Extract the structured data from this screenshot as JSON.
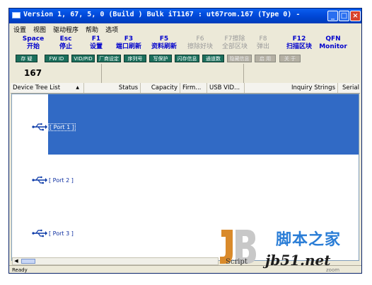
{
  "window": {
    "title": "Version 1, 67, 5, 0 (Build )  Bulk iT1167 : ut67rom.167  (Type 0)  -"
  },
  "menu": [
    "设置",
    "视图",
    "驱动程序",
    "帮助",
    "选项"
  ],
  "function_keys": [
    {
      "key": "Space",
      "label": "开始",
      "enabled": true
    },
    {
      "key": "Esc",
      "label": "停止",
      "enabled": true
    },
    {
      "key": "F1",
      "label": "设置",
      "enabled": true
    },
    {
      "key": "F3",
      "label": "端口刷新",
      "enabled": true
    },
    {
      "key": "F5",
      "label": "资料刷新",
      "enabled": true
    },
    {
      "key": "F6",
      "label": "擦除好块",
      "enabled": false
    },
    {
      "key": "F7擦除",
      "label": "全部区块",
      "enabled": false
    },
    {
      "key": "F8",
      "label": "弹出",
      "enabled": false
    },
    {
      "key": "F12",
      "label": "扫描区块",
      "enabled": true
    },
    {
      "key": "QFN",
      "label": "Monitor",
      "enabled": true
    }
  ],
  "tag_buttons": [
    {
      "label": "存 疑",
      "enabled": true
    },
    {
      "label": "FW ID",
      "enabled": true
    },
    {
      "label": "VID/PID",
      "enabled": true
    },
    {
      "label": "厂商设定",
      "enabled": true
    },
    {
      "label": "序列号",
      "enabled": true
    },
    {
      "label": "写保护",
      "enabled": true
    },
    {
      "label": "闪存信息",
      "enabled": true
    },
    {
      "label": "通道数",
      "enabled": true
    },
    {
      "label": "隐藏信息",
      "enabled": false
    },
    {
      "label": "启 用",
      "enabled": false
    },
    {
      "label": "关 于",
      "enabled": false
    }
  ],
  "counter": "167",
  "columns": [
    "Device Tree List",
    "▲",
    "Status",
    "Capacity",
    "Firm...",
    "USB VID...",
    "Inquiry Strings",
    "Serial"
  ],
  "ports": [
    {
      "label": "[ Port 1 ]",
      "selected": true
    },
    {
      "label": "[ Port 2 ]",
      "selected": false
    },
    {
      "label": "[ Port 3 ]",
      "selected": false
    }
  ],
  "status_bar": "Ready",
  "status_right": "zoom",
  "watermark": {
    "logo": "JB",
    "script": "Script",
    "site_cn": "脚本之家",
    "site_url": "jb51.net"
  },
  "colors": {
    "titlebar": "#0046d5",
    "selection": "#316ac5",
    "fkey_text": "#0000cc",
    "tag_bg": "#1b6f5c"
  }
}
